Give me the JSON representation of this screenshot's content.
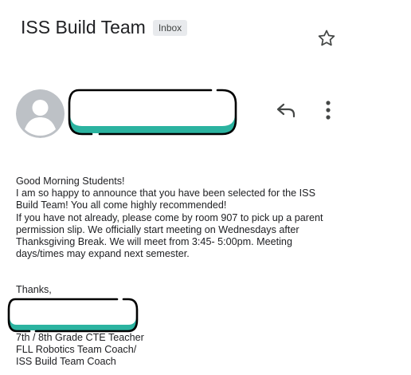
{
  "email": {
    "subject": "ISS Build Team",
    "label": "Inbox",
    "body": [
      "Good Morning Students!",
      "I am so happy to announce that you have been selected for the ISS Build Team! You all come highly recommended!",
      "If you have not already, please come by room 907 to pick up a parent permission slip. We officially start meeting on Wednesdays after Thanksgiving Break. We will meet from 3:45- 5:00pm. Meeting days/times may expand next semester."
    ],
    "closing": "Thanks,",
    "signature": [
      "7th / 8th Grade CTE Teacher",
      "FLL Robotics Team Coach/",
      "ISS Build Team Coach"
    ]
  },
  "icons": {
    "star": "star-icon",
    "reply": "reply-icon",
    "more": "more-vert-icon",
    "avatar": "avatar-icon"
  },
  "colors": {
    "redaction_fill": "#2bb3a0",
    "redaction_outline": "#000000",
    "avatar_bg": "#bdc1c6"
  }
}
